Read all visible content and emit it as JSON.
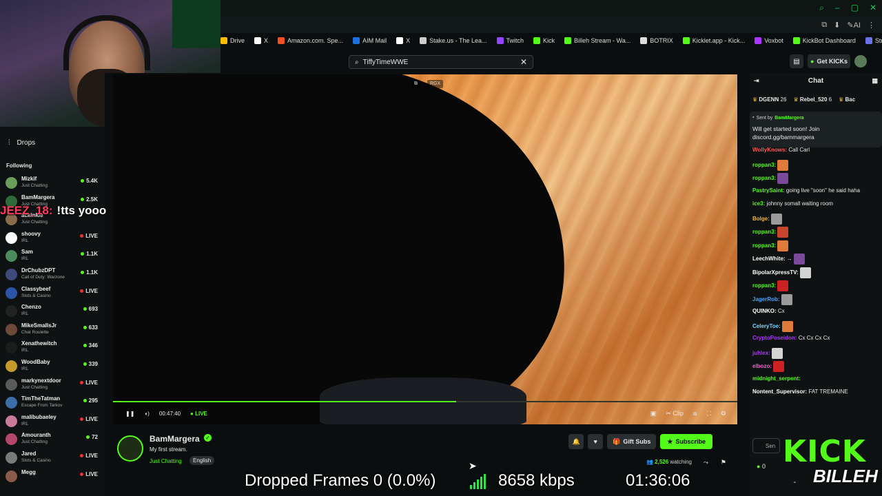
{
  "browser": {
    "bookmarks": [
      {
        "label": "Drive",
        "color": "#fbbc04"
      },
      {
        "label": "X",
        "color": "#ffffff"
      },
      {
        "label": "Amazon.com. Spe...",
        "color": "#f25022"
      },
      {
        "label": "AIM Mail",
        "color": "#1e6fe0"
      },
      {
        "label": "X",
        "color": "#ffffff"
      },
      {
        "label": "Stake.us - The Lea...",
        "color": "#cccccc"
      },
      {
        "label": "Twitch",
        "color": "#9146ff"
      },
      {
        "label": "Kick",
        "color": "#53fc18"
      },
      {
        "label": "Billeh Stream - Wa...",
        "color": "#53fc18"
      },
      {
        "label": "BOTRIX",
        "color": "#dddddd"
      },
      {
        "label": "Kicklet.app - Kick...",
        "color": "#53fc18"
      },
      {
        "label": "Voxbot",
        "color": "#b036ff"
      },
      {
        "label": "KickBot Dashboard",
        "color": "#53fc18"
      },
      {
        "label": "Stripe Express",
        "color": "#6772e5"
      }
    ]
  },
  "search": {
    "value": "TiffyTimeWWE"
  },
  "header": {
    "get_kicks": "Get KICKs"
  },
  "sidebar": {
    "drops": "Drops",
    "following": "Following",
    "items": [
      {
        "name": "Mizkif",
        "category": "Just Chatting",
        "viewers": "5.4K",
        "live": false,
        "color": "#6a9c5a"
      },
      {
        "name": "BamMargera",
        "category": "Just Chatting",
        "viewers": "2.5K",
        "live": false,
        "color": "#2f6b3a"
      },
      {
        "name": "ackinkle",
        "category": "Just Chatting",
        "viewers": "",
        "live": false,
        "color": "#8a6b4e"
      },
      {
        "name": "shoovy",
        "category": "IRL",
        "viewers": "LIVE",
        "live": true,
        "color": "#ffffff"
      },
      {
        "name": "Sam",
        "category": "IRL",
        "viewers": "1.1K",
        "live": false,
        "color": "#4c8b5c"
      },
      {
        "name": "DrChubzDPT",
        "category": "Call of Duty: Warzone",
        "viewers": "1.1K",
        "live": false,
        "color": "#3d4a7a"
      },
      {
        "name": "Classybeef",
        "category": "Slots & Casino",
        "viewers": "LIVE",
        "live": true,
        "color": "#2c55a8"
      },
      {
        "name": "Chenzo",
        "category": "IRL",
        "viewers": "693",
        "live": false,
        "color": "#222222"
      },
      {
        "name": "MikeSmallsJr",
        "category": "Chat Roulette",
        "viewers": "633",
        "live": false,
        "color": "#6b4a3a"
      },
      {
        "name": "Xenathewitch",
        "category": "IRL",
        "viewers": "346",
        "live": false,
        "color": "#1c1c1c"
      },
      {
        "name": "WoodBaby",
        "category": "IRL",
        "viewers": "339",
        "live": false,
        "color": "#c49a2a"
      },
      {
        "name": "markynextdoor",
        "category": "Just Chatting",
        "viewers": "LIVE",
        "live": true,
        "color": "#5a5a5a"
      },
      {
        "name": "TimTheTatman",
        "category": "Escape From Tarkov",
        "viewers": "295",
        "live": false,
        "color": "#3b6ea8"
      },
      {
        "name": "malibubaeley",
        "category": "IRL",
        "viewers": "LIVE",
        "live": true,
        "color": "#c77a9a"
      },
      {
        "name": "Amouranth",
        "category": "Just Chatting",
        "viewers": "72",
        "live": false,
        "color": "#b3486b"
      },
      {
        "name": "Jared",
        "category": "Slots & Casino",
        "viewers": "LIVE",
        "live": true,
        "color": "#7a7a7a"
      },
      {
        "name": "Megg",
        "category": "",
        "viewers": "LIVE",
        "live": true,
        "color": "#8a5a4a"
      }
    ]
  },
  "overlay_chat": {
    "user": "JEEZ_18:",
    "text": "!tts yooo"
  },
  "player": {
    "time": "00:47:40",
    "live": "LIVE",
    "progress": 0.55,
    "clip": "Clip",
    "top_icons": [
      "⧉",
      "RGX"
    ]
  },
  "channel": {
    "name": "BamMargera",
    "title": "My first stream.",
    "category": "Just Chatting",
    "language": "English",
    "gift_subs": "Gift Subs",
    "subscribe": "Subscribe",
    "watching_count": "2,526",
    "watching_label": "watching"
  },
  "chat": {
    "title": "Chat",
    "leaders": [
      {
        "name": "DGENN",
        "count": "26"
      },
      {
        "name": "Rebel_520",
        "count": "6"
      },
      {
        "name": "Bac",
        "count": ""
      }
    ],
    "pinned_by_label": "Sent by",
    "pinned_by": "BamMargera",
    "pinned_msg": "Will get started soon! Join discord.gg/bammargera",
    "messages": [
      {
        "user": "WollyKnows:",
        "color": "#ff5a5a",
        "text": "Call Carl",
        "emote": false
      },
      {
        "user": "roppan3:",
        "color": "#53fc18",
        "text": "",
        "emote": true
      },
      {
        "user": "roppan3:",
        "color": "#53fc18",
        "text": "",
        "emote": true
      },
      {
        "user": "PastrySaint:",
        "color": "#53fc18",
        "text": "going live \"soon\" he said haha",
        "emote": false
      },
      {
        "user": "ice3:",
        "color": "#53fc18",
        "text": "johnny somall waiting room",
        "emote": false
      },
      {
        "user": "Bolge:",
        "color": "#f0b93a",
        "text": "",
        "emote": true
      },
      {
        "user": "roppan3:",
        "color": "#53fc18",
        "text": "",
        "emote": true
      },
      {
        "user": "roppan3:",
        "color": "#53fc18",
        "text": "",
        "emote": true
      },
      {
        "user": "LeechWhite:",
        "color": "#ffffff",
        "text": "→",
        "emote": true
      },
      {
        "user": "BipolarXpressTV:",
        "color": "#ffffff",
        "text": "",
        "emote": true
      },
      {
        "user": "roppan3:",
        "color": "#53fc18",
        "text": "",
        "emote": true
      },
      {
        "user": "JagerRob:",
        "color": "#4aa3ff",
        "text": "",
        "emote": true
      },
      {
        "user": "QUINKO:",
        "color": "#ffffff",
        "text": "Cx",
        "emote": false
      },
      {
        "user": "CeleryToe:",
        "color": "#7ad4ff",
        "text": "",
        "emote": true
      },
      {
        "user": "CryptoPoseidon:",
        "color": "#b036ff",
        "text": "Cx Cx Cx Cx",
        "emote": false
      },
      {
        "user": "juhlex:",
        "color": "#b036ff",
        "text": "",
        "emote": true
      },
      {
        "user": "elbozo:",
        "color": "#ff5ad4",
        "text": "",
        "emote": true
      },
      {
        "user": "midnight_serpent:",
        "color": "#53fc18",
        "text": "",
        "emote": false
      },
      {
        "user": "Nontent_Supervisor:",
        "color": "#ffffff",
        "text": "FAT TREMAINE",
        "emote": false
      }
    ],
    "input_placeholder": "Sen",
    "count": "0"
  },
  "brand": {
    "kick": "KICK",
    "billeh": "BILLEH"
  },
  "stream_stats": {
    "dropped_frames": "Dropped Frames 0 (0.0%)",
    "bitrate": "8658 kbps",
    "elapsed": "01:36:06"
  },
  "colors": {
    "accent": "#53fc18",
    "bg": "#0b0e0f",
    "panel": "#0f1213"
  }
}
